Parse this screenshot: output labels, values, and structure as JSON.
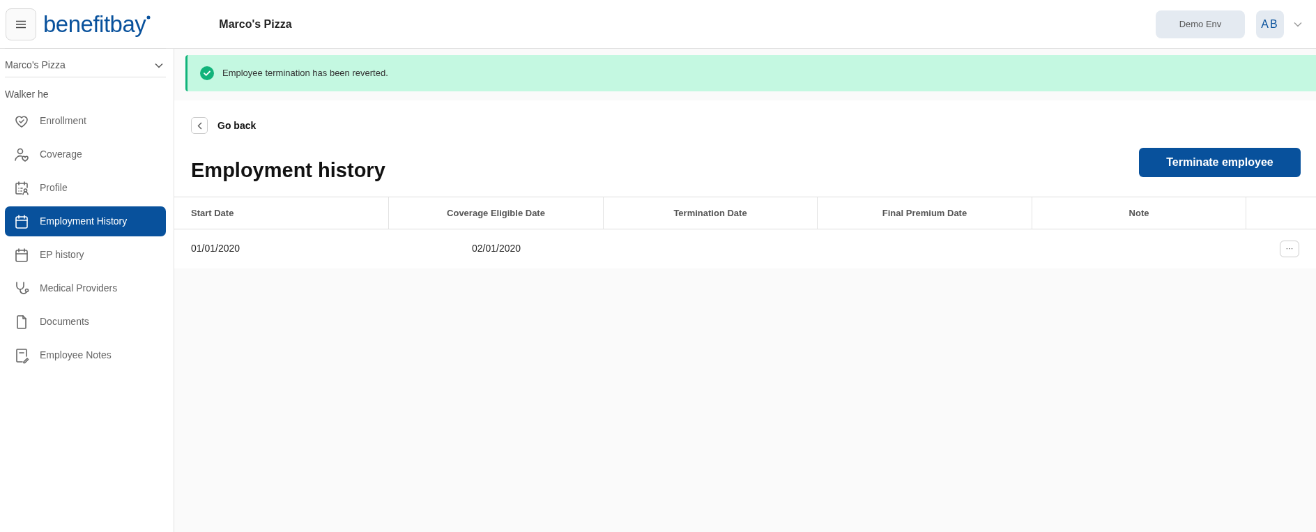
{
  "header": {
    "logo": "benefitbay",
    "company": "Marco's Pizza",
    "env_button": "Demo Env",
    "avatar": "AB"
  },
  "sidebar": {
    "company_select": "Marco's Pizza",
    "employee": "Walker he",
    "items": [
      {
        "label": "Enrollment",
        "selected": false
      },
      {
        "label": "Coverage",
        "selected": false
      },
      {
        "label": "Profile",
        "selected": false
      },
      {
        "label": "Employment History",
        "selected": true
      },
      {
        "label": "EP history",
        "selected": false
      },
      {
        "label": "Medical Providers",
        "selected": false
      },
      {
        "label": "Documents",
        "selected": false
      },
      {
        "label": "Employee Notes",
        "selected": false
      }
    ]
  },
  "alert": {
    "kind": "success",
    "message": "Employee termination has been reverted."
  },
  "back_link": "Go back",
  "title": "Employment history",
  "primary_button": "Terminate employee",
  "table": {
    "columns": [
      "Start Date",
      "Coverage Eligible Date",
      "Termination Date",
      "Final Premium Date",
      "Note"
    ],
    "rows": [
      {
        "cells": [
          "01/01/2020",
          "02/01/2020",
          "",
          "",
          ""
        ],
        "actions": "···"
      }
    ]
  }
}
